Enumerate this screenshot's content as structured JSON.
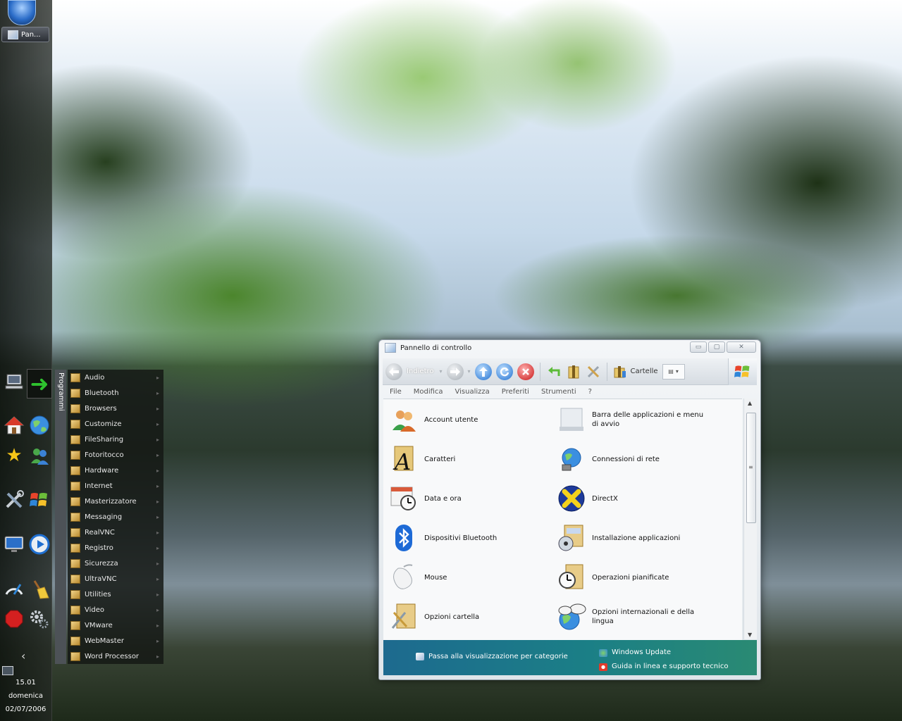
{
  "taskbar": {
    "task_label": "Pan...",
    "programs_label": "Programmi",
    "clock_time": "15.01",
    "clock_day": "domenica",
    "clock_date": "02/07/2006",
    "collapse_glyph": "‹"
  },
  "dock_icons": [
    "computer-icon",
    "run-arrow-icon",
    "home-icon",
    "globe-icon",
    "favorites-star-icon",
    "users-icon",
    "tools-icon",
    "windows-flag-icon",
    "display-icon",
    "media-player-icon",
    "gauge-icon",
    "broom-icon",
    "stop-sign-icon",
    "gears-icon"
  ],
  "programs_menu": {
    "items": [
      "Audio",
      "Bluetooth",
      "Browsers",
      "Customize",
      "FileSharing",
      "Fotoritocco",
      "Hardware",
      "Internet",
      "Masterizzatore",
      "Messaging",
      "RealVNC",
      "Registro",
      "Sicurezza",
      "UltraVNC",
      "Utilities",
      "Video",
      "VMware",
      "WebMaster",
      "Word Processor"
    ]
  },
  "window": {
    "title": "Pannello di controllo",
    "controls": {
      "minimize": "▭",
      "maximize": "▢",
      "close": "✕"
    },
    "toolbar": {
      "back_label": "Indietro",
      "folders_label": "Cartelle",
      "dropdown_glyph": "▾"
    },
    "menu": [
      "File",
      "Modifica",
      "Visualizza",
      "Preferiti",
      "Strumenti",
      "?"
    ],
    "items": [
      {
        "label": "Account utente",
        "icon": "users-icon"
      },
      {
        "label": "Barra delle applicazioni e menu di avvio",
        "icon": "taskbar-icon"
      },
      {
        "label": "Caratteri",
        "icon": "fonts-icon"
      },
      {
        "label": "Connessioni di rete",
        "icon": "network-globe-icon"
      },
      {
        "label": "Data e ora",
        "icon": "clock-calendar-icon"
      },
      {
        "label": "DirectX",
        "icon": "directx-icon"
      },
      {
        "label": "Dispositivi Bluetooth",
        "icon": "bluetooth-icon"
      },
      {
        "label": "Installazione applicazioni",
        "icon": "add-remove-programs-icon"
      },
      {
        "label": "Mouse",
        "icon": "mouse-icon"
      },
      {
        "label": "Operazioni pianificate",
        "icon": "scheduled-tasks-icon"
      },
      {
        "label": "Opzioni cartella",
        "icon": "folder-options-icon"
      },
      {
        "label": "Opzioni internazionali e della lingua",
        "icon": "regional-language-icon"
      }
    ],
    "footer": {
      "switch_view": "Passa alla visualizzazione per categorie",
      "windows_update": "Windows Update",
      "help": "Guida in linea e supporto tecnico"
    }
  }
}
